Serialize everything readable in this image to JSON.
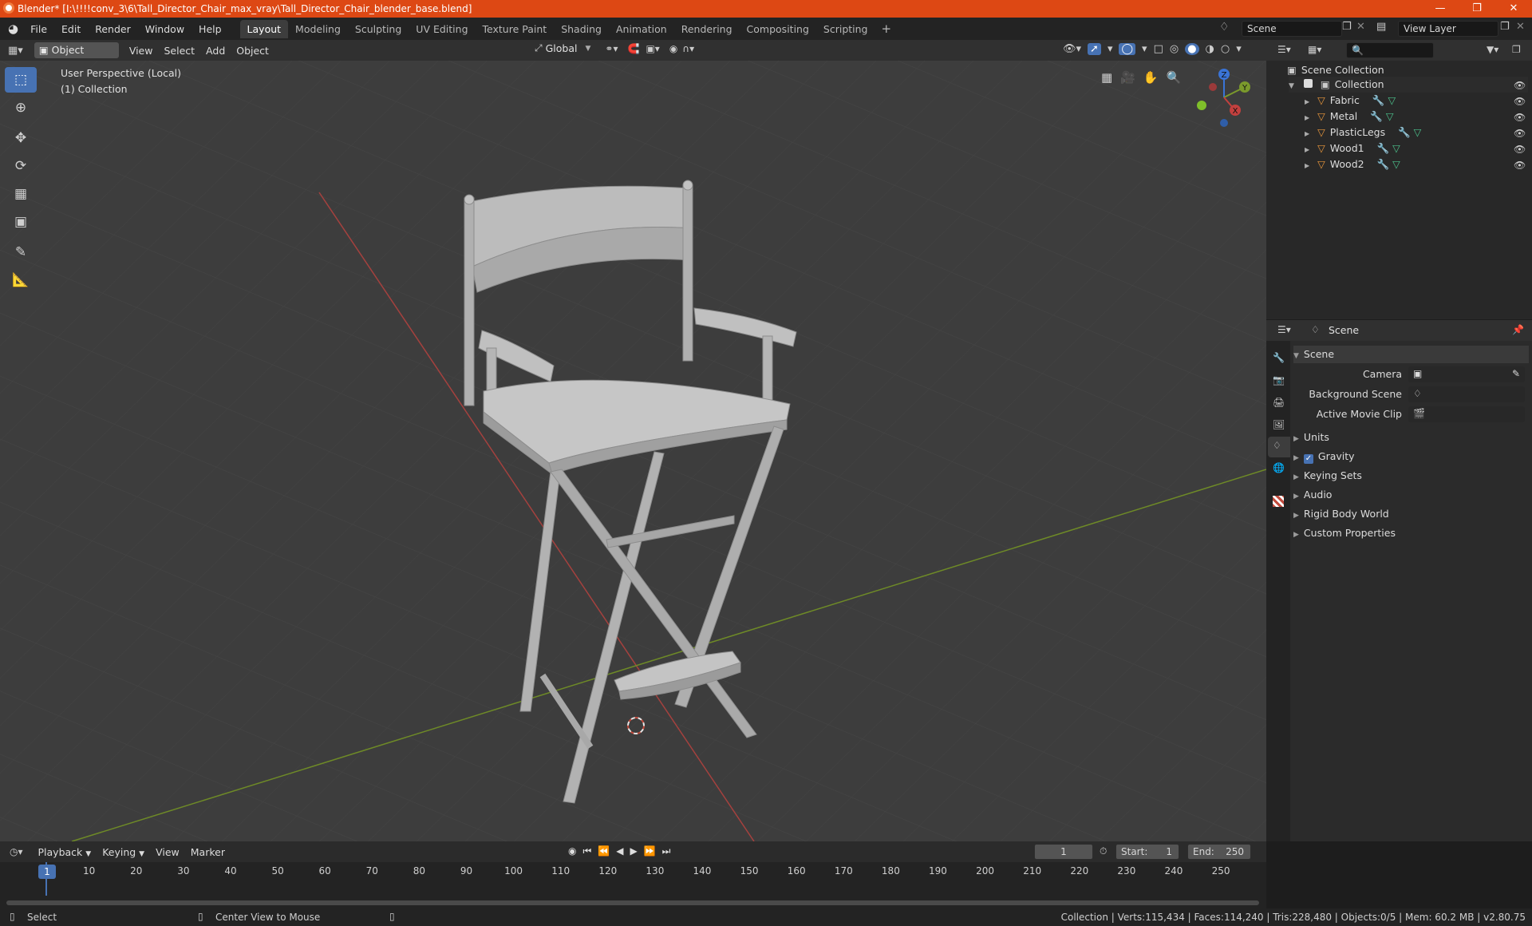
{
  "window": {
    "title": "Blender* [I:\\!!!!conv_3\\6\\Tall_Director_Chair_max_vray\\Tall_Director_Chair_blender_base.blend]",
    "min_icon": "minimize-icon",
    "max_icon": "restore-icon",
    "close_icon": "close-icon"
  },
  "menu": {
    "file": "File",
    "edit": "Edit",
    "render": "Render",
    "window": "Window",
    "help": "Help"
  },
  "workspaces": [
    "Layout",
    "Modeling",
    "Sculpting",
    "UV Editing",
    "Texture Paint",
    "Shading",
    "Animation",
    "Rendering",
    "Compositing",
    "Scripting"
  ],
  "scene_field": "Scene",
  "view_layer_field": "View Layer",
  "header": {
    "mode": "Object Mode",
    "view": "View",
    "select": "Select",
    "add": "Add",
    "object": "Object",
    "transform": "Global"
  },
  "viewport": {
    "perspective": "User Perspective (Local)",
    "collection": "(1) Collection",
    "gizmo": {
      "x": "X",
      "y": "Y",
      "z": "Z"
    }
  },
  "outliner": {
    "scene_collection": "Scene Collection",
    "collection": "Collection",
    "objects": [
      "Fabric",
      "Metal",
      "PlasticLegs",
      "Wood1",
      "Wood2"
    ]
  },
  "properties": {
    "context": "Scene",
    "panel_scene": "Scene",
    "camera_label": "Camera",
    "background_scene_label": "Background Scene",
    "active_movie_clip_label": "Active Movie Clip",
    "panels": [
      "Units",
      "Gravity",
      "Keying Sets",
      "Audio",
      "Rigid Body World",
      "Custom Properties"
    ],
    "gravity_checked": true
  },
  "timeline": {
    "playback": "Playback",
    "keying": "Keying",
    "view": "View",
    "marker": "Marker",
    "current_frame": "1",
    "start_label": "Start:",
    "start": "1",
    "end_label": "End:",
    "end": "250",
    "ruler": [
      "1",
      "10",
      "20",
      "30",
      "40",
      "50",
      "60",
      "70",
      "80",
      "90",
      "100",
      "110",
      "120",
      "130",
      "140",
      "150",
      "160",
      "170",
      "180",
      "190",
      "200",
      "210",
      "220",
      "230",
      "240",
      "250"
    ]
  },
  "status": {
    "select": "Select",
    "center": "Center View to Mouse",
    "stats": "Collection | Verts:115,434 | Faces:114,240 | Tris:228,480 | Objects:0/5 | Mem: 60.2 MB | v2.80.75"
  },
  "colors": {
    "accent": "#4772b3",
    "title_bar": "#dd4814",
    "x_axis": "#c2403e",
    "y_axis": "#7b9a2c",
    "z_axis": "#3a74d6"
  }
}
